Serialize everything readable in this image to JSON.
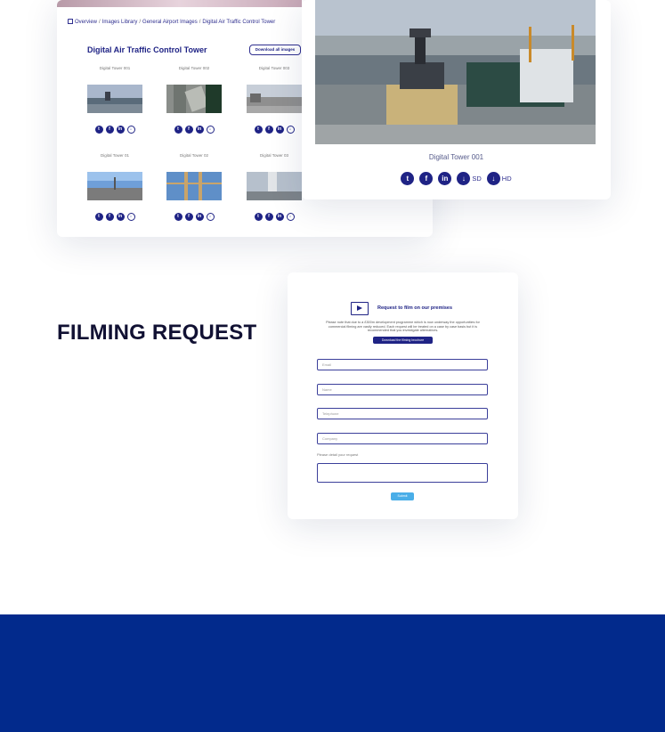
{
  "gallery": {
    "breadcrumb": [
      "Overview",
      "Images Library",
      "General Airport Images",
      "Digital Air Traffic Control Tower"
    ],
    "separator": "/",
    "title": "Digital Air Traffic Control Tower",
    "download_all": "Download all images",
    "tiles": [
      {
        "label": "Digital Tower 001"
      },
      {
        "label": "Digital Tower 002"
      },
      {
        "label": "Digital Tower 003"
      },
      {
        "label": "Digital Tower 01"
      },
      {
        "label": "Digital Tower 02"
      },
      {
        "label": "Digital Tower 03"
      }
    ],
    "tile_icons": [
      "twitter-icon",
      "facebook-icon",
      "linkedin-icon",
      "download-icon"
    ]
  },
  "detail": {
    "caption": "Digital Tower 001",
    "icons": [
      "twitter-icon",
      "facebook-icon",
      "linkedin-icon"
    ],
    "downloads": [
      {
        "label": "SD"
      },
      {
        "label": "HD"
      }
    ]
  },
  "section": {
    "title": "FILMING REQUEST"
  },
  "form": {
    "heading": "Request to film on our premises",
    "notice": "Please note that due to a £300m development programme which is now underway the opportunities for commercial filming are vastly reduced. Each request will be treated on a case by case basis but it is recommended that you investigate alternatives.",
    "brochure_button": "Download the filming brochure",
    "fields": [
      {
        "placeholder": "Email"
      },
      {
        "placeholder": "Name"
      },
      {
        "placeholder": "Telephone"
      },
      {
        "placeholder": "Company"
      }
    ],
    "detail_label": "Please detail your request",
    "submit": "Submit"
  },
  "colors": {
    "brand": "#1f2385",
    "footer": "#022a8c",
    "submit": "#4aaee8"
  }
}
